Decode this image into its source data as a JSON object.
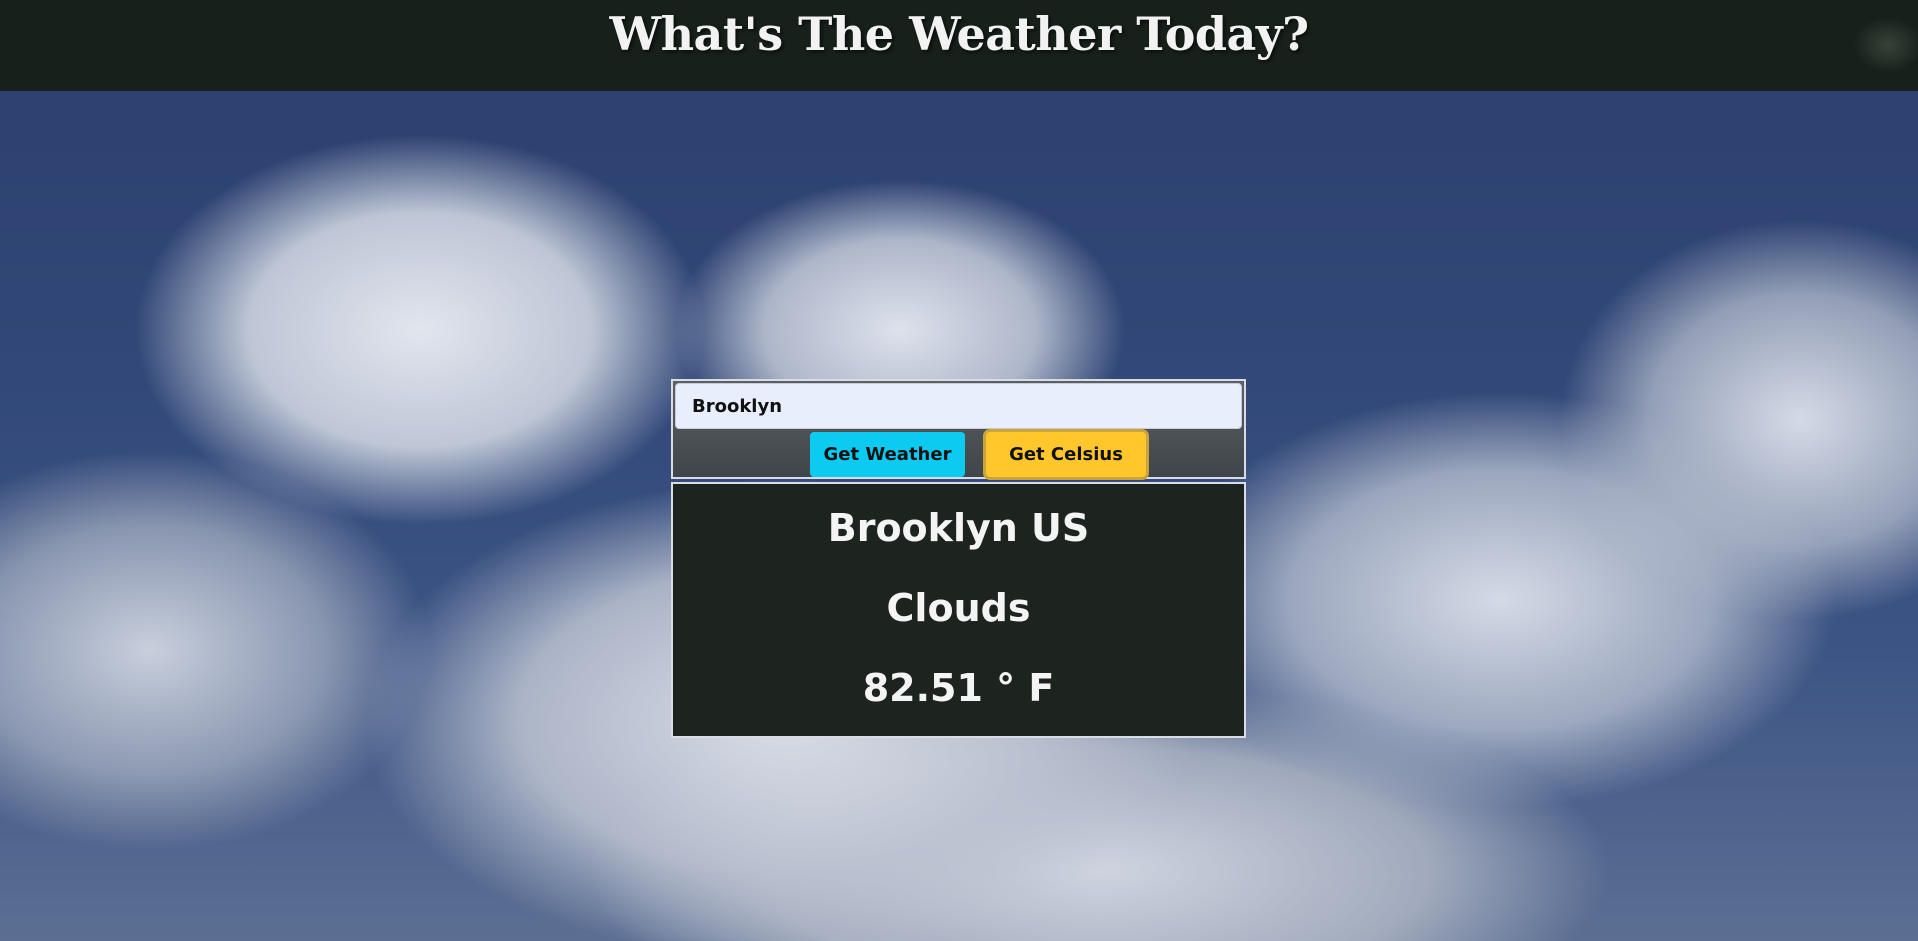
{
  "header": {
    "title": "What's The Weather Today?"
  },
  "search": {
    "value": "Brooklyn",
    "placeholder": ""
  },
  "buttons": {
    "get_weather": "Get Weather",
    "get_celsius": "Get Celsius"
  },
  "result": {
    "location": "Brooklyn US",
    "condition": "Clouds",
    "temperature": "82.51  ° F"
  },
  "colors": {
    "header_bg": "#17201b",
    "weather_button": "#0dcaf0",
    "celsius_button": "#ffc72c",
    "result_bg": "#1d231f"
  }
}
